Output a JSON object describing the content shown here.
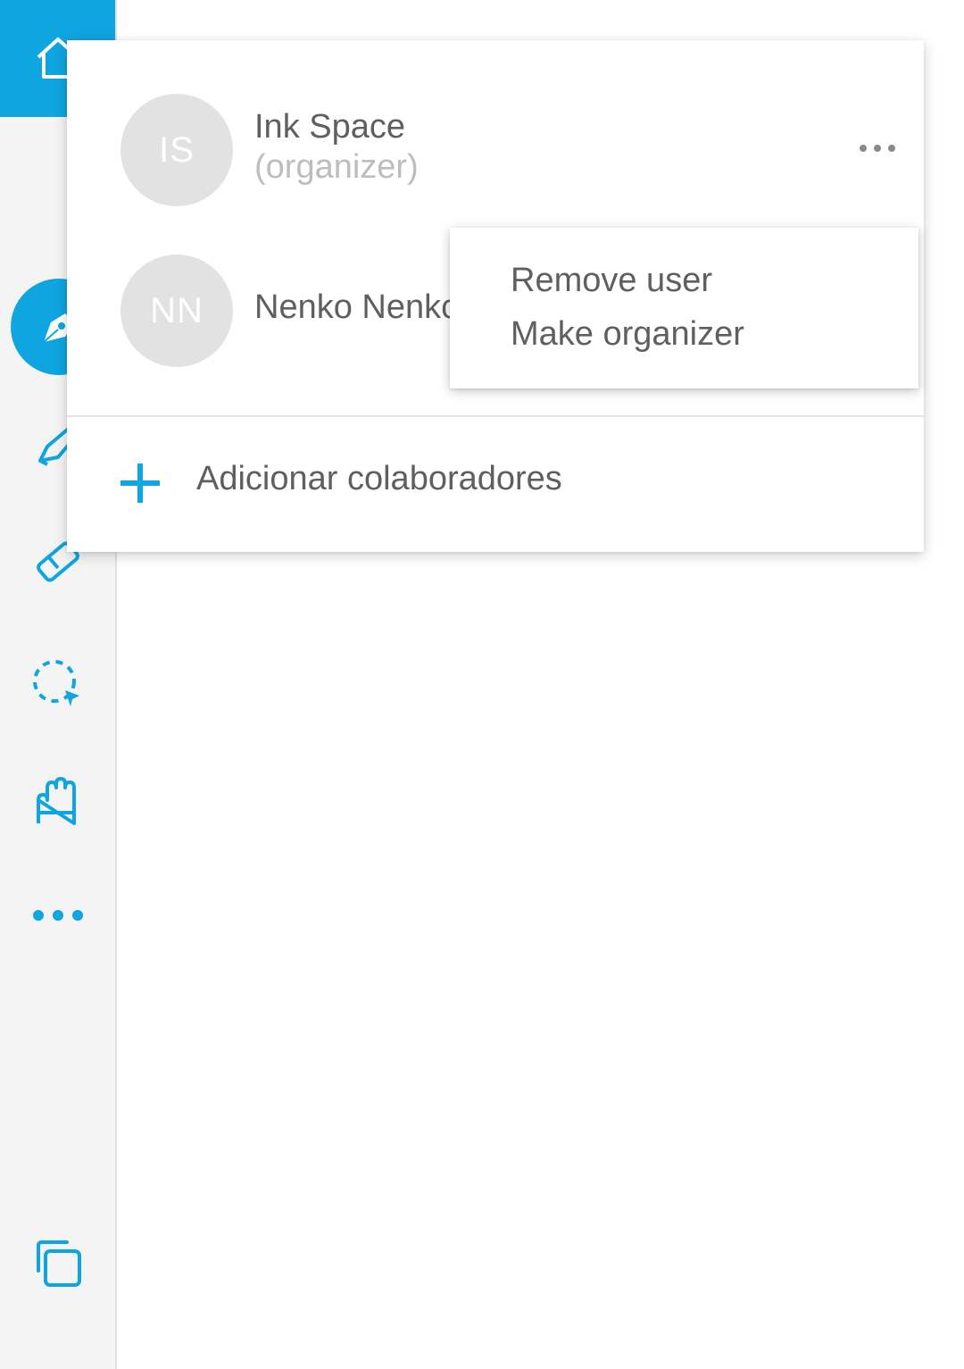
{
  "colors": {
    "accent": "#0ea5e0",
    "sidebar_bg": "#f4f4f4",
    "avatar_bg": "#e2e2e2",
    "text": "#5f5f5f",
    "muted_text": "#bdbdbd"
  },
  "sidebar": {
    "tools": [
      {
        "name": "home",
        "icon": "home-icon",
        "active": true
      },
      {
        "name": "pen",
        "icon": "pen-icon",
        "active": true
      },
      {
        "name": "highlighter",
        "icon": "highlighter-icon"
      },
      {
        "name": "eraser",
        "icon": "eraser-icon"
      },
      {
        "name": "lasso-select",
        "icon": "lasso-select-icon"
      },
      {
        "name": "pan",
        "icon": "hand-icon"
      },
      {
        "name": "more",
        "icon": "more-horizontal-icon"
      },
      {
        "name": "fullscreen",
        "icon": "fullscreen-icon"
      }
    ]
  },
  "collaborators": {
    "users": [
      {
        "initials": "IS",
        "name": "Ink Space",
        "role": "(organizer)"
      },
      {
        "initials": "NN",
        "name": "Nenko Nenkc",
        "role": ""
      }
    ],
    "add_label": "Adicionar colaboradores"
  },
  "context_menu": {
    "items": [
      "Remove user",
      "Make organizer"
    ]
  }
}
